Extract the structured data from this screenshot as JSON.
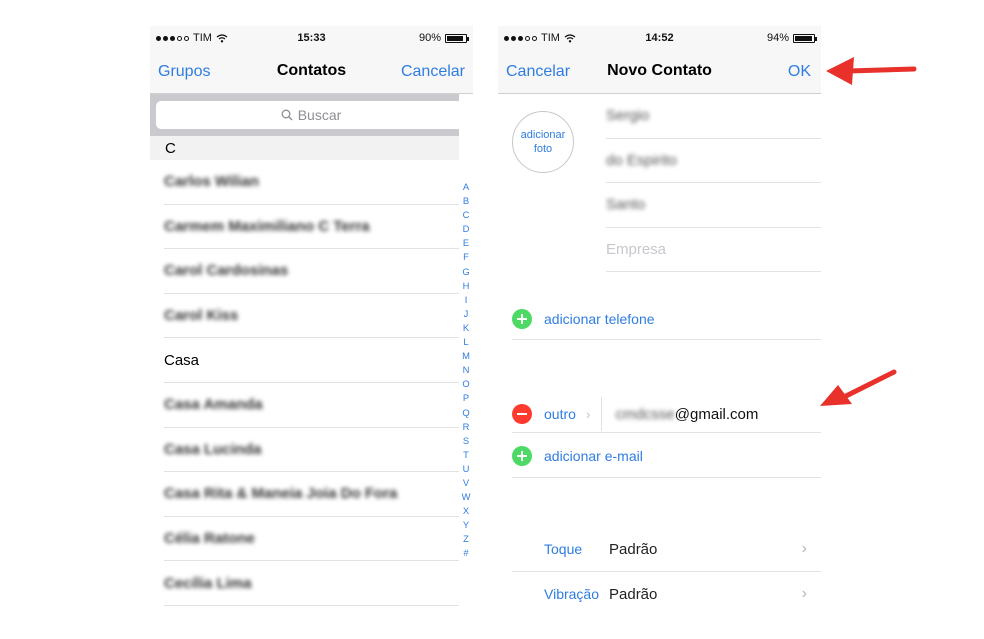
{
  "left_screen": {
    "status": {
      "carrier": "TIM",
      "time": "15:33",
      "battery": "90%",
      "battery_level": 0.9
    },
    "nav": {
      "left_button": "Grupos",
      "title": "Contatos",
      "right_button": "Cancelar"
    },
    "search": {
      "placeholder": "Buscar"
    },
    "section_letter": "C",
    "contacts": [
      {
        "name": "Carlos Wilian",
        "blurred": true
      },
      {
        "name": "Carmem Maximiliano C Terra",
        "blurred": true
      },
      {
        "name": "Carol Cardosinas",
        "blurred": true
      },
      {
        "name": "Carol Kiss",
        "blurred": true
      },
      {
        "name": "Casa",
        "blurred": false
      },
      {
        "name": "Casa Amanda",
        "blurred": true
      },
      {
        "name": "Casa Lucinda",
        "blurred": true
      },
      {
        "name": "Casa Rita & Maneia Joia Do Fora",
        "blurred": true
      },
      {
        "name": "Célia Ratone",
        "blurred": true
      },
      {
        "name": "Cecília Lima",
        "blurred": true
      }
    ],
    "index_letters": [
      "A",
      "B",
      "C",
      "D",
      "E",
      "F",
      "G",
      "H",
      "I",
      "J",
      "K",
      "L",
      "M",
      "N",
      "O",
      "P",
      "Q",
      "R",
      "S",
      "T",
      "U",
      "V",
      "W",
      "X",
      "Y",
      "Z",
      "#"
    ]
  },
  "right_screen": {
    "status": {
      "carrier": "TIM",
      "time": "14:52",
      "battery": "94%",
      "battery_level": 0.94
    },
    "nav": {
      "left_button": "Cancelar",
      "title": "Novo Contato",
      "right_button": "OK"
    },
    "photo": {
      "line1": "adicionar",
      "line2": "foto"
    },
    "fields": [
      {
        "value": "Sergio",
        "blurred": true
      },
      {
        "value": "do Espirito",
        "blurred": true
      },
      {
        "value": "Santo",
        "blurred": true
      },
      {
        "value": "Empresa",
        "blurred": false,
        "placeholder": true
      }
    ],
    "add_phone": "adicionar telefone",
    "email": {
      "label": "outro",
      "value_hidden": "cmdcsse",
      "value_visible": "@gmail.com"
    },
    "add_email": "adicionar e-mail",
    "settings": [
      {
        "label": "Toque",
        "value": "Padrão"
      },
      {
        "label": "Vibração",
        "value": "Padrão"
      }
    ]
  },
  "colors": {
    "ios_blue": "#2f7de1",
    "arrow_red": "#e8312a",
    "add_green": "#4cd964",
    "remove_red": "#ff3b30"
  }
}
